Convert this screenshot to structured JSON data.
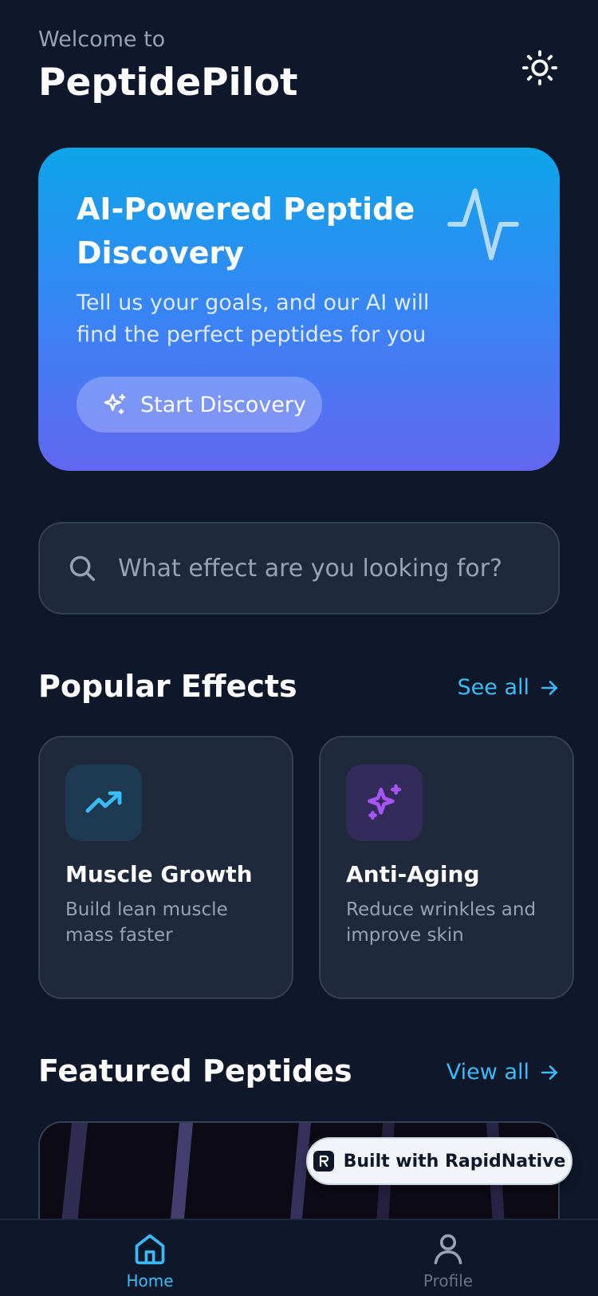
{
  "header": {
    "welcome": "Welcome to",
    "app_name": "PeptidePilot",
    "theme_icon": "sun-icon"
  },
  "hero": {
    "title": "AI-Powered Peptide Discovery",
    "description": "Tell us your goals, and our AI will find the perfect peptides for you",
    "button_label": "Start Discovery",
    "button_icon": "sparkles-icon",
    "decor_icon": "activity-pulse-icon",
    "gradient": [
      "#0ea5e9",
      "#3b82f6",
      "#6366f1"
    ]
  },
  "search": {
    "placeholder": "What effect are you looking for?",
    "icon": "search-icon"
  },
  "popular_effects": {
    "title": "Popular Effects",
    "link_label": "See all",
    "items": [
      {
        "name": "Muscle Growth",
        "description": "Build lean muscle mass faster",
        "icon": "trending-up-icon",
        "accent": "#38bdf8"
      },
      {
        "name": "Anti-Aging",
        "description": "Reduce wrinkles and improve skin",
        "icon": "sparkles-icon",
        "accent": "#a855f7"
      }
    ]
  },
  "featured_peptides": {
    "title": "Featured Peptides",
    "link_label": "View all"
  },
  "badge": {
    "label": "Built with RapidNative"
  },
  "tabbar": {
    "items": [
      {
        "label": "Home",
        "icon": "home-icon",
        "active": true
      },
      {
        "label": "Profile",
        "icon": "user-icon",
        "active": false
      }
    ],
    "active_color": "#38bdf8",
    "inactive_color": "#64748b"
  },
  "colors": {
    "background": "#0f172a",
    "card": "#1e293b",
    "accent": "#38bdf8"
  }
}
